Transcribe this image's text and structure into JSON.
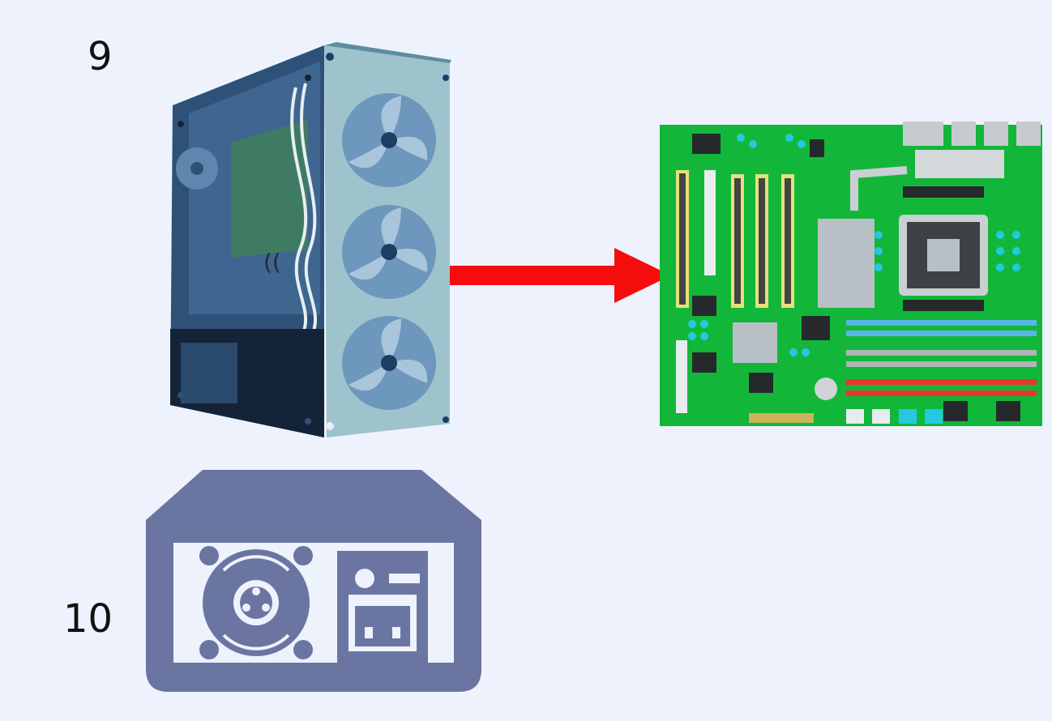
{
  "steps": {
    "first": "9",
    "second": "10"
  },
  "illustrations": {
    "case": "pc-case-illustration",
    "motherboard": "motherboard-illustration",
    "psu": "power-supply-icon",
    "arrow": "arrow-right-icon"
  },
  "colors": {
    "background": "#eef2fd",
    "arrow": "#f50c0c",
    "psu": "#6b75a2",
    "board_green": "#12b73a"
  }
}
